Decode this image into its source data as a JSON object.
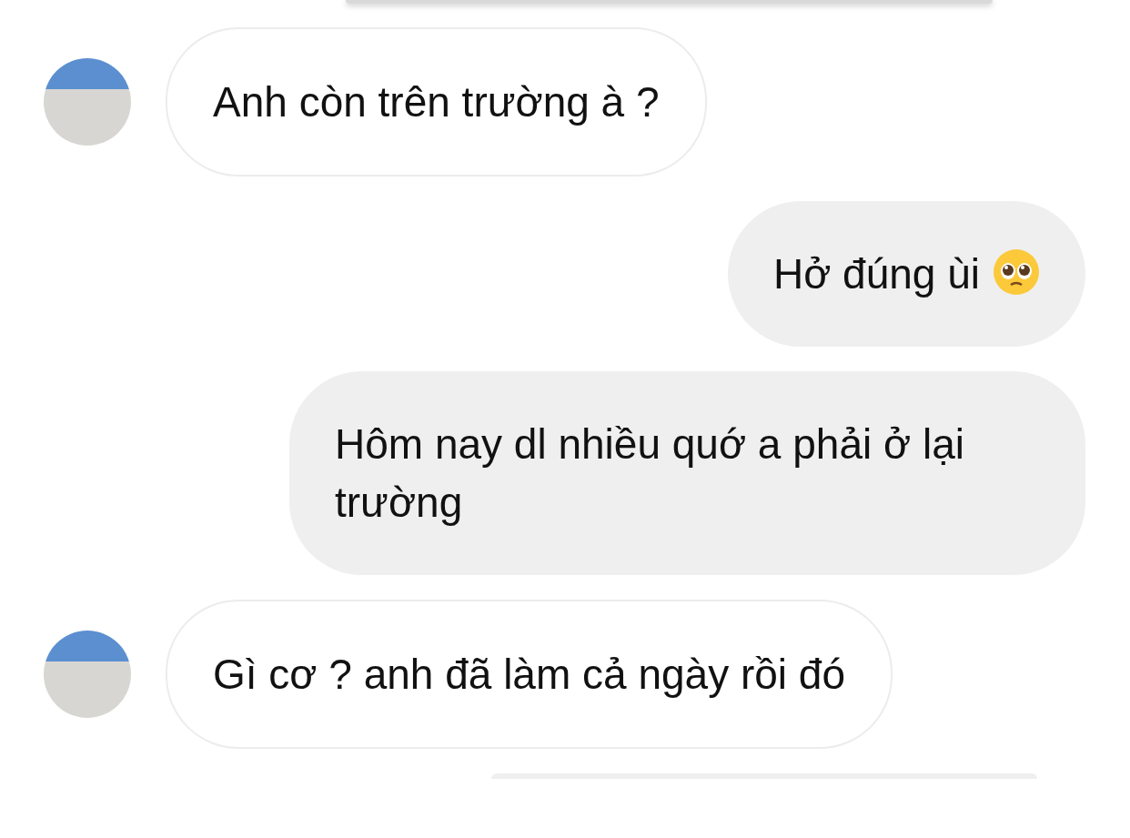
{
  "messages": [
    {
      "kind": "incoming",
      "text": "Anh còn trên trường à ?",
      "has_emoji": false
    },
    {
      "kind": "outgoing",
      "text": "Hở đúng ùi",
      "has_emoji": true
    },
    {
      "kind": "outgoing",
      "text": "Hôm nay dl nhiều quớ a phải ở lại trường",
      "has_emoji": false
    },
    {
      "kind": "incoming",
      "text": "Gì cơ ? anh đã làm cả ngày rồi đó",
      "has_emoji": false
    }
  ]
}
